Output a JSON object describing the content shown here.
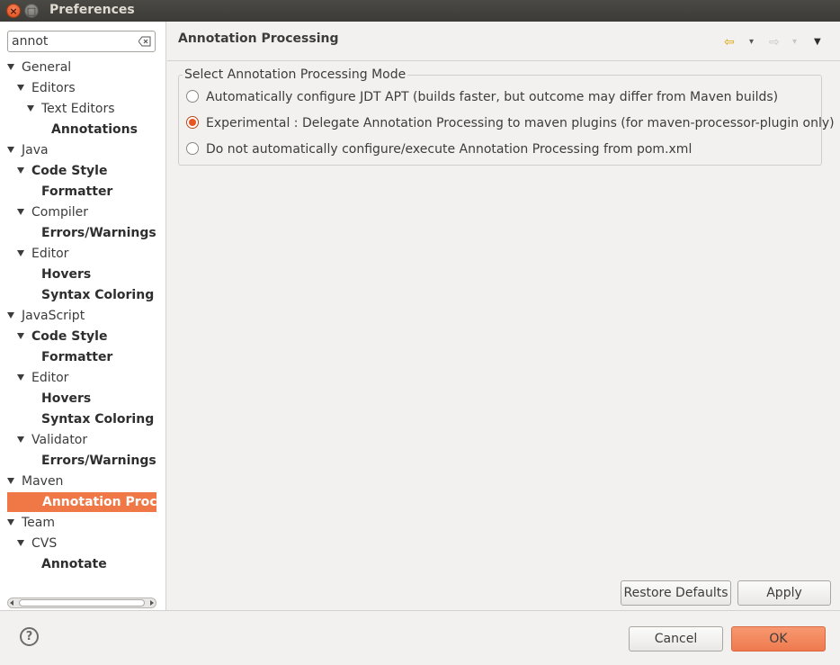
{
  "window": {
    "title": "Preferences",
    "close_glyph": "×",
    "minimize_glyph": "□"
  },
  "filter": {
    "value": "annot"
  },
  "tree": [
    {
      "label": "General",
      "bold": false,
      "arrow": true
    },
    {
      "label": "Editors",
      "bold": false,
      "arrow": true
    },
    {
      "label": "Text Editors",
      "bold": false,
      "arrow": true
    },
    {
      "label": "Annotations",
      "bold": true,
      "arrow": false
    },
    {
      "label": "Java",
      "bold": false,
      "arrow": true
    },
    {
      "label": "Code Style",
      "bold": true,
      "arrow": true
    },
    {
      "label": "Formatter",
      "bold": true,
      "arrow": false
    },
    {
      "label": "Compiler",
      "bold": false,
      "arrow": true
    },
    {
      "label": "Errors/Warnings",
      "bold": true,
      "arrow": false
    },
    {
      "label": "Editor",
      "bold": false,
      "arrow": true
    },
    {
      "label": "Hovers",
      "bold": true,
      "arrow": false
    },
    {
      "label": "Syntax Coloring",
      "bold": true,
      "arrow": false
    },
    {
      "label": "JavaScript",
      "bold": false,
      "arrow": true
    },
    {
      "label": "Code Style",
      "bold": true,
      "arrow": true
    },
    {
      "label": "Formatter",
      "bold": true,
      "arrow": false
    },
    {
      "label": "Editor",
      "bold": false,
      "arrow": true
    },
    {
      "label": "Hovers",
      "bold": true,
      "arrow": false
    },
    {
      "label": "Syntax Coloring",
      "bold": true,
      "arrow": false
    },
    {
      "label": "Validator",
      "bold": false,
      "arrow": true
    },
    {
      "label": "Errors/Warnings",
      "bold": true,
      "arrow": false
    },
    {
      "label": "Maven",
      "bold": false,
      "arrow": true
    },
    {
      "label": "Annotation Processing",
      "bold": true,
      "arrow": false,
      "selected": true
    },
    {
      "label": "Team",
      "bold": false,
      "arrow": true
    },
    {
      "label": "CVS",
      "bold": false,
      "arrow": true
    },
    {
      "label": "Annotate",
      "bold": true,
      "arrow": false
    }
  ],
  "page": {
    "title": "Annotation Processing",
    "group_label": "Select Annotation Processing Mode",
    "options": [
      {
        "label": "Automatically configure JDT APT (builds faster, but outcome may differ from Maven builds)",
        "selected": false
      },
      {
        "label": "Experimental : Delegate Annotation Processing to maven plugins (for maven-processor-plugin only)",
        "selected": true
      },
      {
        "label": "Do not automatically configure/execute Annotation Processing from pom.xml",
        "selected": false
      }
    ]
  },
  "nav": {
    "back_glyph": "⇦",
    "forward_glyph": "⇨",
    "menu_glyph": "▼",
    "dropdown_glyph": "▾"
  },
  "buttons": {
    "restore_defaults": "Restore Defaults",
    "apply": "Apply",
    "cancel": "Cancel",
    "ok": "OK"
  },
  "help": {
    "glyph": "?"
  },
  "colors": {
    "selection": "#f07746",
    "ok_button": "#ef7a4f",
    "nav_back": "#d9a400"
  }
}
